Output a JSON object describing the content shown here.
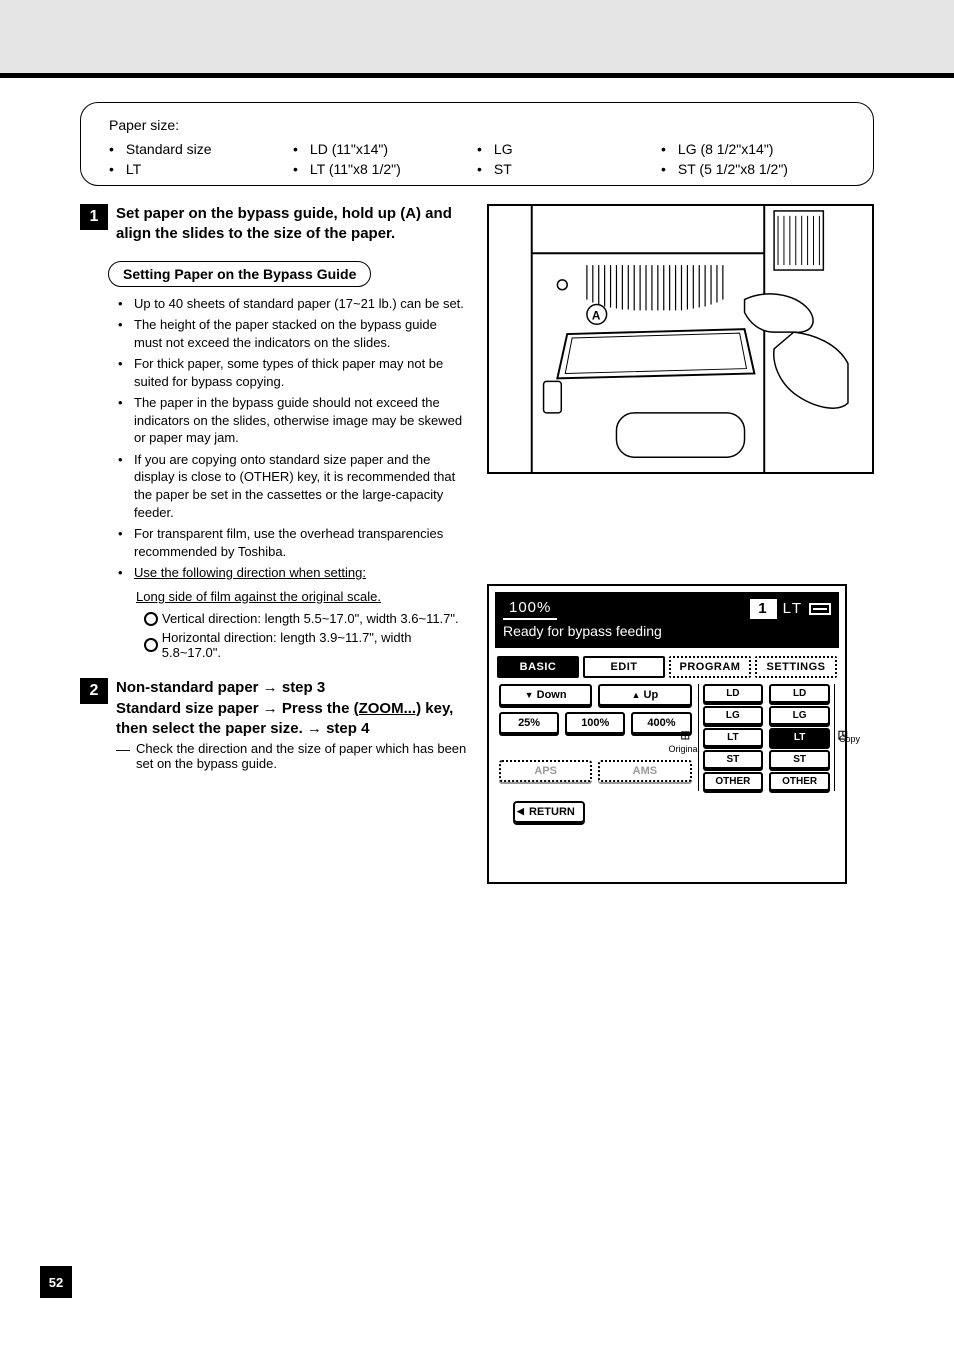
{
  "header": {
    "blank": ""
  },
  "sizes_box": {
    "label": "Paper size:",
    "items": [
      "Standard size",
      "LD (11\"x14\")",
      "LG",
      "LG (8 1/2\"x14\")",
      "LT",
      "LT (11\"x8 1/2\")",
      "ST",
      "ST (5 1/2\"x8 1/2\")"
    ]
  },
  "step1": {
    "num": "1",
    "text": "Set paper on the bypass guide, hold up (A) and align the slides to the size of the paper."
  },
  "tips_label": "Setting Paper on the Bypass Guide",
  "tips": [
    "Up to 40 sheets of standard paper (17~21 lb.) can be set.",
    "The height of the paper stacked on the bypass guide must not exceed the indicators on the slides.",
    "For thick paper, some types of thick paper may not be suited for bypass copying.",
    "The paper in the bypass guide should not exceed the indicators on the slides, otherwise image may be skewed or paper may jam.",
    "If you are copying onto standard size paper and the display is close to (OTHER) key, it is recommended that the paper be set in the cassettes or the large-capacity feeder."
  ],
  "tip6": "For transparent film, use the overhead transparencies recommended by Toshiba.",
  "tip7_lead": "Use the following direction when setting:",
  "tip7_a": "Long side of film against the original scale.",
  "tip7_b": "Vertical direction: length 5.5~17.0\", width 3.6~11.7\".",
  "tip7_c": "Horizontal direction: length 3.9~11.7\", width 5.8~17.0\".",
  "step2": {
    "num": "2",
    "text1": "Non-standard paper → step 3",
    "text2a": "Standard size paper → Press the",
    "text2b": "(ZOOM...)",
    "text2c": "key, then select the paper size. → step 4",
    "note_dash": "—",
    "note": "Check the direction and the size of paper which has been set on the bypass guide."
  },
  "lcd": {
    "pct": "100%",
    "count": "1",
    "size_ind": "LT",
    "status": "Ready for bypass feeding",
    "tabs": {
      "basic": "BASIC",
      "edit": "EDIT",
      "program": "PROGRAM",
      "settings": "SETTINGS"
    },
    "down": "Down",
    "up": "Up",
    "z25": "25%",
    "z100": "100%",
    "z400": "400%",
    "aps": "APS",
    "ams": "AMS",
    "original_label": "Original",
    "copy_label": "Copy",
    "sizes": {
      "ld": "LD",
      "lg": "LG",
      "lt": "LT",
      "st": "ST",
      "other": "OTHER"
    },
    "return": "RETURN"
  },
  "page_number": "52"
}
